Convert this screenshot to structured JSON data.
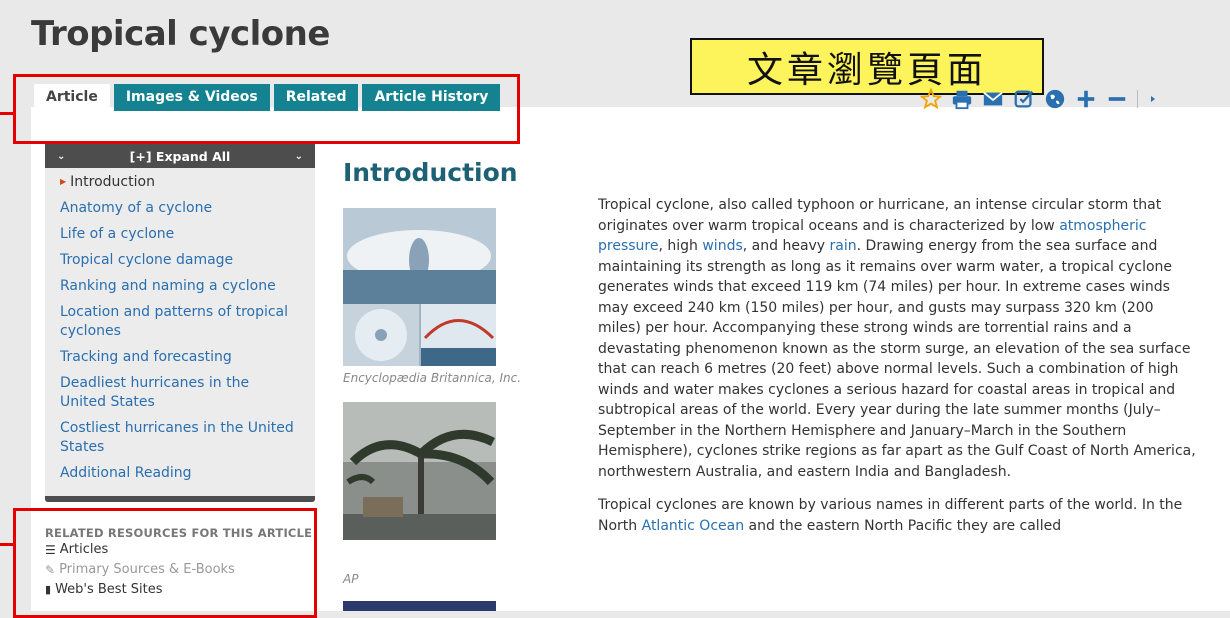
{
  "page": {
    "title": "Tropical cyclone"
  },
  "annotation": {
    "text": "文章瀏覽頁面"
  },
  "tabs": [
    {
      "label": "Article"
    },
    {
      "label": "Images & Videos"
    },
    {
      "label": "Related"
    },
    {
      "label": "Article History"
    }
  ],
  "toolbar": [
    "star-icon",
    "print-icon",
    "email-icon",
    "cite-icon",
    "globe-icon",
    "zoom-in-icon",
    "zoom-out-icon",
    "more-icon"
  ],
  "toc": {
    "expand_label": "[+] Expand All",
    "items": [
      "Introduction",
      "Anatomy of a cyclone",
      "Life of a cyclone",
      "Tropical cyclone damage",
      "Ranking and naming a cyclone",
      "Location and patterns of tropical cyclones",
      "Tracking and forecasting",
      "Deadliest hurricanes in the United States",
      "Costliest hurricanes in the United States",
      "Additional Reading"
    ]
  },
  "related": {
    "heading": "RELATED RESOURCES FOR THIS ARTICLE",
    "items": [
      "Articles",
      "Primary Sources & E-Books",
      "Web's Best Sites"
    ]
  },
  "main": {
    "section_title": "Introduction",
    "captions": [
      "Encyclopædia Britannica, Inc.",
      "AP"
    ],
    "p1": {
      "t1": "Tropical cyclone,  also called typhoon or hurricane,  an intense circular storm that originates over warm tropical oceans and is characterized by low ",
      "l1": "atmospheric pressure",
      "t2": ", high ",
      "l2": "winds",
      "t3": ", and heavy ",
      "l3": "rain",
      "t4": ". Drawing energy from the sea surface and maintaining its strength as long as it remains over warm water, a tropical cyclone generates winds that exceed 119 km (74 miles) per hour. In extreme cases winds may exceed 240 km (150 miles) per hour, and gusts may surpass 320 km (200 miles) per hour. Accompanying these strong winds are torrential rains and a devastating phenomenon known as the storm surge, an elevation of the sea surface that can reach 6 metres (20 feet) above normal levels. Such a combination of high winds and water makes cyclones a serious hazard for coastal areas in tropical and subtropical areas of the world. Every year during the late summer months (July–September in the Northern Hemisphere and January–March in the Southern Hemisphere), cyclones strike regions as far apart as the Gulf Coast of North America, northwestern Australia, and eastern India and Bangladesh."
    },
    "p2": {
      "t1": "Tropical cyclones are known by various names in different parts of the world. In the North ",
      "l1": "Atlantic Ocean",
      "t2": " and the eastern North Pacific they are called"
    }
  },
  "colors": {
    "tab": "#148290",
    "link": "#2a6fb0",
    "heading": "#1c6274",
    "annotation_bg": "#fdf35b",
    "highlight_border": "#e50000"
  }
}
